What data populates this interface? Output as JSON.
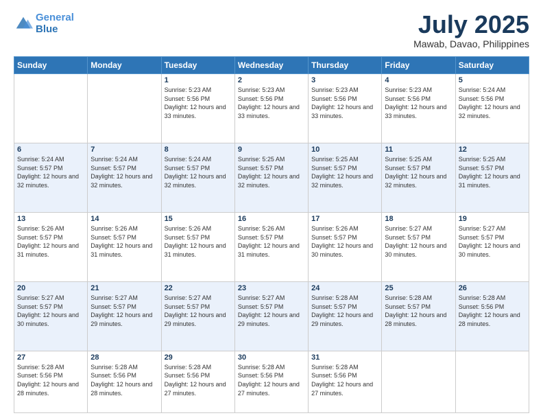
{
  "logo": {
    "line1": "General",
    "line2": "Blue"
  },
  "title": "July 2025",
  "subtitle": "Mawab, Davao, Philippines",
  "weekdays": [
    "Sunday",
    "Monday",
    "Tuesday",
    "Wednesday",
    "Thursday",
    "Friday",
    "Saturday"
  ],
  "weeks": [
    [
      {
        "day": "",
        "sunrise": "",
        "sunset": "",
        "daylight": ""
      },
      {
        "day": "",
        "sunrise": "",
        "sunset": "",
        "daylight": ""
      },
      {
        "day": "1",
        "sunrise": "Sunrise: 5:23 AM",
        "sunset": "Sunset: 5:56 PM",
        "daylight": "Daylight: 12 hours and 33 minutes."
      },
      {
        "day": "2",
        "sunrise": "Sunrise: 5:23 AM",
        "sunset": "Sunset: 5:56 PM",
        "daylight": "Daylight: 12 hours and 33 minutes."
      },
      {
        "day": "3",
        "sunrise": "Sunrise: 5:23 AM",
        "sunset": "Sunset: 5:56 PM",
        "daylight": "Daylight: 12 hours and 33 minutes."
      },
      {
        "day": "4",
        "sunrise": "Sunrise: 5:23 AM",
        "sunset": "Sunset: 5:56 PM",
        "daylight": "Daylight: 12 hours and 33 minutes."
      },
      {
        "day": "5",
        "sunrise": "Sunrise: 5:24 AM",
        "sunset": "Sunset: 5:56 PM",
        "daylight": "Daylight: 12 hours and 32 minutes."
      }
    ],
    [
      {
        "day": "6",
        "sunrise": "Sunrise: 5:24 AM",
        "sunset": "Sunset: 5:57 PM",
        "daylight": "Daylight: 12 hours and 32 minutes."
      },
      {
        "day": "7",
        "sunrise": "Sunrise: 5:24 AM",
        "sunset": "Sunset: 5:57 PM",
        "daylight": "Daylight: 12 hours and 32 minutes."
      },
      {
        "day": "8",
        "sunrise": "Sunrise: 5:24 AM",
        "sunset": "Sunset: 5:57 PM",
        "daylight": "Daylight: 12 hours and 32 minutes."
      },
      {
        "day": "9",
        "sunrise": "Sunrise: 5:25 AM",
        "sunset": "Sunset: 5:57 PM",
        "daylight": "Daylight: 12 hours and 32 minutes."
      },
      {
        "day": "10",
        "sunrise": "Sunrise: 5:25 AM",
        "sunset": "Sunset: 5:57 PM",
        "daylight": "Daylight: 12 hours and 32 minutes."
      },
      {
        "day": "11",
        "sunrise": "Sunrise: 5:25 AM",
        "sunset": "Sunset: 5:57 PM",
        "daylight": "Daylight: 12 hours and 32 minutes."
      },
      {
        "day": "12",
        "sunrise": "Sunrise: 5:25 AM",
        "sunset": "Sunset: 5:57 PM",
        "daylight": "Daylight: 12 hours and 31 minutes."
      }
    ],
    [
      {
        "day": "13",
        "sunrise": "Sunrise: 5:26 AM",
        "sunset": "Sunset: 5:57 PM",
        "daylight": "Daylight: 12 hours and 31 minutes."
      },
      {
        "day": "14",
        "sunrise": "Sunrise: 5:26 AM",
        "sunset": "Sunset: 5:57 PM",
        "daylight": "Daylight: 12 hours and 31 minutes."
      },
      {
        "day": "15",
        "sunrise": "Sunrise: 5:26 AM",
        "sunset": "Sunset: 5:57 PM",
        "daylight": "Daylight: 12 hours and 31 minutes."
      },
      {
        "day": "16",
        "sunrise": "Sunrise: 5:26 AM",
        "sunset": "Sunset: 5:57 PM",
        "daylight": "Daylight: 12 hours and 31 minutes."
      },
      {
        "day": "17",
        "sunrise": "Sunrise: 5:26 AM",
        "sunset": "Sunset: 5:57 PM",
        "daylight": "Daylight: 12 hours and 30 minutes."
      },
      {
        "day": "18",
        "sunrise": "Sunrise: 5:27 AM",
        "sunset": "Sunset: 5:57 PM",
        "daylight": "Daylight: 12 hours and 30 minutes."
      },
      {
        "day": "19",
        "sunrise": "Sunrise: 5:27 AM",
        "sunset": "Sunset: 5:57 PM",
        "daylight": "Daylight: 12 hours and 30 minutes."
      }
    ],
    [
      {
        "day": "20",
        "sunrise": "Sunrise: 5:27 AM",
        "sunset": "Sunset: 5:57 PM",
        "daylight": "Daylight: 12 hours and 30 minutes."
      },
      {
        "day": "21",
        "sunrise": "Sunrise: 5:27 AM",
        "sunset": "Sunset: 5:57 PM",
        "daylight": "Daylight: 12 hours and 29 minutes."
      },
      {
        "day": "22",
        "sunrise": "Sunrise: 5:27 AM",
        "sunset": "Sunset: 5:57 PM",
        "daylight": "Daylight: 12 hours and 29 minutes."
      },
      {
        "day": "23",
        "sunrise": "Sunrise: 5:27 AM",
        "sunset": "Sunset: 5:57 PM",
        "daylight": "Daylight: 12 hours and 29 minutes."
      },
      {
        "day": "24",
        "sunrise": "Sunrise: 5:28 AM",
        "sunset": "Sunset: 5:57 PM",
        "daylight": "Daylight: 12 hours and 29 minutes."
      },
      {
        "day": "25",
        "sunrise": "Sunrise: 5:28 AM",
        "sunset": "Sunset: 5:57 PM",
        "daylight": "Daylight: 12 hours and 28 minutes."
      },
      {
        "day": "26",
        "sunrise": "Sunrise: 5:28 AM",
        "sunset": "Sunset: 5:56 PM",
        "daylight": "Daylight: 12 hours and 28 minutes."
      }
    ],
    [
      {
        "day": "27",
        "sunrise": "Sunrise: 5:28 AM",
        "sunset": "Sunset: 5:56 PM",
        "daylight": "Daylight: 12 hours and 28 minutes."
      },
      {
        "day": "28",
        "sunrise": "Sunrise: 5:28 AM",
        "sunset": "Sunset: 5:56 PM",
        "daylight": "Daylight: 12 hours and 28 minutes."
      },
      {
        "day": "29",
        "sunrise": "Sunrise: 5:28 AM",
        "sunset": "Sunset: 5:56 PM",
        "daylight": "Daylight: 12 hours and 27 minutes."
      },
      {
        "day": "30",
        "sunrise": "Sunrise: 5:28 AM",
        "sunset": "Sunset: 5:56 PM",
        "daylight": "Daylight: 12 hours and 27 minutes."
      },
      {
        "day": "31",
        "sunrise": "Sunrise: 5:28 AM",
        "sunset": "Sunset: 5:56 PM",
        "daylight": "Daylight: 12 hours and 27 minutes."
      },
      {
        "day": "",
        "sunrise": "",
        "sunset": "",
        "daylight": ""
      },
      {
        "day": "",
        "sunrise": "",
        "sunset": "",
        "daylight": ""
      }
    ]
  ]
}
